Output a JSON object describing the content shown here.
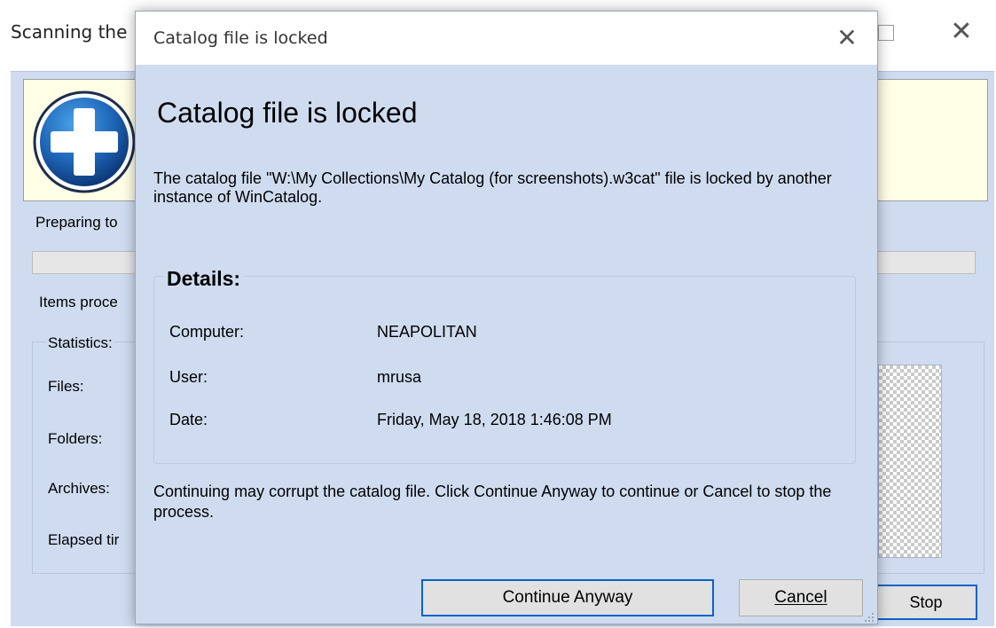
{
  "background_window": {
    "title": "Scanning the",
    "close_glyph": "✕",
    "preparing_text": "Preparing to",
    "items_processed_text": "Items proce",
    "statistics_label": "Statistics:",
    "stats": [
      {
        "label": "Files:"
      },
      {
        "label": "Folders:"
      },
      {
        "label": "Archives:"
      },
      {
        "label": "Elapsed tir"
      }
    ],
    "stop_button": "Stop",
    "banner_icon": "medical-plus-icon"
  },
  "dialog": {
    "window_title": "Catalog file is locked",
    "close_glyph": "✕",
    "heading": "Catalog file is locked",
    "message": "The catalog file \"W:\\My Collections\\My Catalog (for screenshots).w3cat\" file is locked by another instance of WinCatalog.",
    "details": {
      "heading": "Details:",
      "rows": [
        {
          "label": "Computer:",
          "value": "NEAPOLITAN"
        },
        {
          "label": "User:",
          "value": "mrusa"
        },
        {
          "label": "Date:",
          "value": "Friday, May 18, 2018 1:46:08 PM"
        }
      ]
    },
    "footer_message": "Continuing may corrupt the catalog file. Click Continue Anyway to continue or Cancel to stop the process.",
    "buttons": {
      "continue": "Continue Anyway",
      "cancel": "Cancel"
    }
  },
  "colors": {
    "dialog_bg": "#cfdcf0",
    "banner_bg": "#ffffe6",
    "focus_border": "#0a63c9"
  }
}
